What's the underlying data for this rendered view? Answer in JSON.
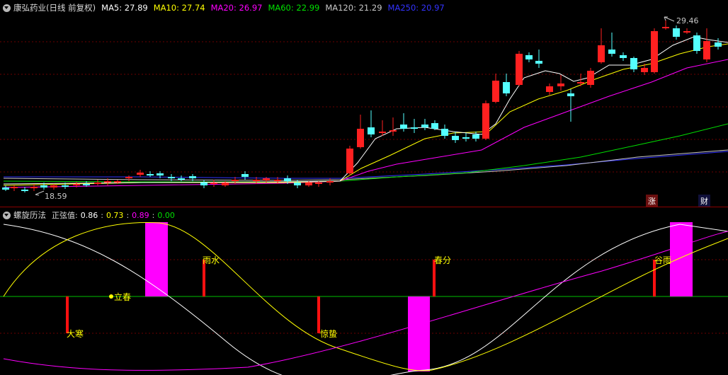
{
  "main": {
    "title": "康弘药业(日线 前复权)",
    "ma": [
      {
        "label": "MA5: 27.89",
        "color": "#ffffff"
      },
      {
        "label": "MA10: 27.74",
        "color": "#ffff00"
      },
      {
        "label": "MA20: 26.97",
        "color": "#ff00ff"
      },
      {
        "label": "MA60: 22.99",
        "color": "#00e000"
      },
      {
        "label": "MA120: 21.29",
        "color": "#c8c8c8"
      },
      {
        "label": "MA250: 20.97",
        "color": "#3333ff"
      }
    ],
    "high_label": "29.46",
    "low_label": "18.59",
    "tags": {
      "zhang": "涨",
      "cai": "财"
    }
  },
  "sub": {
    "title": "螺旋历法",
    "value_prefix": "正弦值:",
    "values": [
      {
        "text": "0.86",
        "color": "#ffffff"
      },
      {
        "text": "0.73",
        "color": "#ffff00"
      },
      {
        "text": "0.89",
        "color": "#ff00ff"
      },
      {
        "text": "0.00",
        "color": "#00e000"
      }
    ],
    "solar_terms": [
      "大寒",
      "立春",
      "雨水",
      "惊蛰",
      "春分",
      "谷雨"
    ]
  },
  "colors": {
    "up": "#ff2020",
    "down": "#54ffff",
    "grid": "#6b0000",
    "zero_line": "#00c000",
    "magenta": "#ff00ff"
  }
}
